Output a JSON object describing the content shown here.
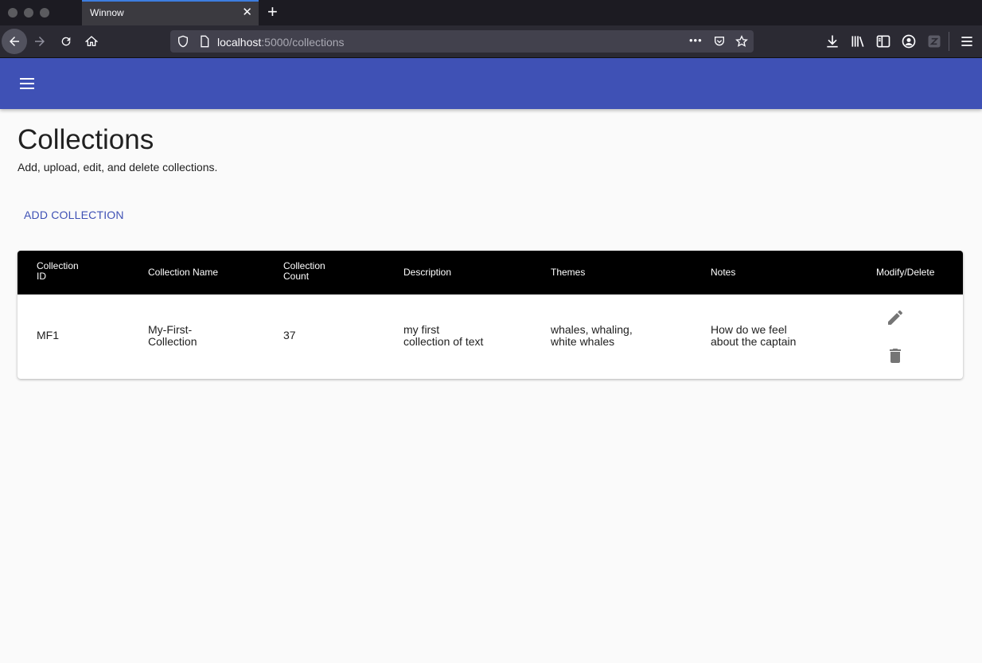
{
  "browser": {
    "tab_title": "Winnow",
    "tab_close": "✕",
    "new_tab": "+",
    "url_host": "localhost",
    "url_path": ":5000/collections",
    "url_more": "•••"
  },
  "page": {
    "title": "Collections",
    "subtitle": "Add, upload, edit, and delete collections.",
    "add_button": "ADD COLLECTION"
  },
  "table": {
    "headers": {
      "collection_id": [
        "Collection",
        "ID"
      ],
      "collection_name": "Collection Name",
      "collection_count": [
        "Collection",
        "Count"
      ],
      "description": "Description",
      "themes": "Themes",
      "notes": "Notes",
      "modify_delete": "Modify/Delete"
    },
    "rows": [
      {
        "id": "MF1",
        "name": [
          "My-First-",
          "Collection"
        ],
        "count": "37",
        "description": [
          "my first",
          "collection of text"
        ],
        "themes": [
          "whales, whaling,",
          "white whales"
        ],
        "notes": [
          "How do we feel",
          "about the captain"
        ]
      }
    ]
  },
  "colors": {
    "appbar": "#3f51b5",
    "accent": "#3f51b5",
    "table_header": "#000000",
    "icon": "#757575"
  }
}
